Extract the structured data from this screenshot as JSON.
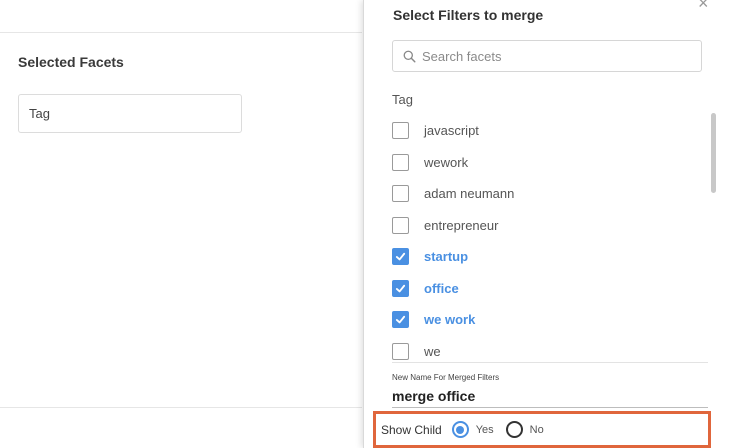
{
  "left": {
    "section_title": "Selected Facets",
    "tag_value": "Tag"
  },
  "dialog": {
    "title": "Select Filters to merge",
    "close_icon": "×",
    "search_placeholder": "Search facets",
    "group_label": "Tag",
    "items": [
      {
        "label": "javascript",
        "checked": false
      },
      {
        "label": "wework",
        "checked": false
      },
      {
        "label": "adam neumann",
        "checked": false
      },
      {
        "label": "entrepreneur",
        "checked": false
      },
      {
        "label": "startup",
        "checked": true
      },
      {
        "label": "office",
        "checked": true
      },
      {
        "label": "we work",
        "checked": true
      },
      {
        "label": "we",
        "checked": false
      }
    ],
    "name_label": "New Name For Merged Filters",
    "name_value": "merge office",
    "show_child": {
      "label": "Show Child",
      "yes_label": "Yes",
      "no_label": "No",
      "selected": "Yes"
    }
  },
  "colors": {
    "accent": "#4a90e2",
    "highlight_border": "#e0663c"
  }
}
